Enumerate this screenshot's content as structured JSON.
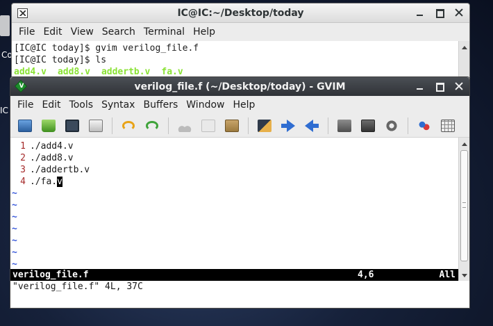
{
  "desktop": {
    "label_a": "Co",
    "label_b": "IC"
  },
  "terminal": {
    "title": "IC@IC:~/Desktop/today",
    "menu": [
      "File",
      "Edit",
      "View",
      "Search",
      "Terminal",
      "Help"
    ],
    "lines": [
      "[IC@IC today]$ gvim verilog_file.f",
      "[IC@IC today]$ ls"
    ],
    "ls_output": [
      "add4.v",
      "add8.v",
      "addertb.v",
      "fa.v"
    ],
    "colors": {
      "ls_files": "#8ae234"
    }
  },
  "gvim": {
    "title": "verilog_file.f (~/Desktop/today) - GVIM",
    "menu": [
      "File",
      "Edit",
      "Tools",
      "Syntax",
      "Buffers",
      "Window",
      "Help"
    ],
    "toolbar_icons": [
      "open-icon",
      "save-download-icon",
      "save-icon",
      "print-icon",
      "undo-icon",
      "redo-icon",
      "cut-icon",
      "copy-icon",
      "paste-icon",
      "find-replace-icon",
      "forward-arrow-icon",
      "back-arrow-icon",
      "session-load-icon",
      "session-save-icon",
      "run-script-icon",
      "tags-icon",
      "table-icon"
    ],
    "buffer_lines": [
      {
        "num": "1",
        "text": "./add4.v"
      },
      {
        "num": "2",
        "text": "./add8.v"
      },
      {
        "num": "3",
        "text": "./addertb.v"
      },
      {
        "num": "4",
        "text_before_cursor": "./fa.",
        "cursor_char": "v"
      }
    ],
    "tilde": "~",
    "status": {
      "filename": "verilog_file.f",
      "position": "4,6",
      "scroll": "All"
    },
    "message": "\"verilog_file.f\" 4L, 37C",
    "colors": {
      "line_number": "#a52a2a",
      "tilde": "#3b5bdb",
      "statusline_bg": "#000000"
    }
  }
}
